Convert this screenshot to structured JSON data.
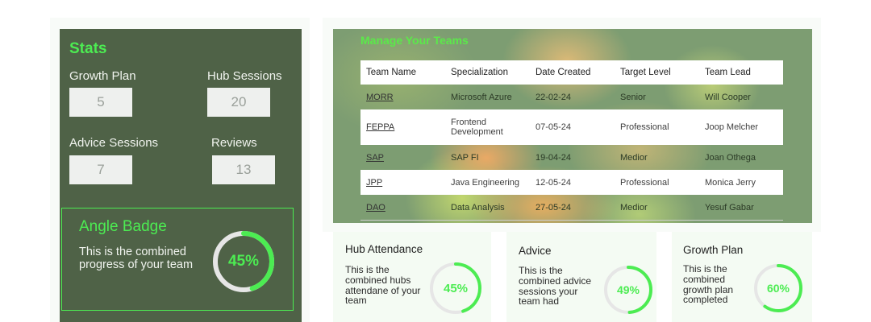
{
  "stats": {
    "title": "Stats",
    "growth_plan": {
      "label": "Growth Plan",
      "value": "5"
    },
    "hub_sessions": {
      "label": "Hub Sessions",
      "value": "20"
    },
    "advice_sessions": {
      "label": "Advice Sessions",
      "value": "7"
    },
    "reviews": {
      "label": "Reviews",
      "value": "13"
    },
    "angle_badge": {
      "title": "Angle Badge",
      "text": "This is the combined progress of your team",
      "percent_label": "45%",
      "progress": 0.45
    }
  },
  "teams": {
    "title": "Manage Your Teams",
    "columns": [
      "Team Name",
      "Specialization",
      "Date Created",
      "Target Level",
      "Team Lead"
    ],
    "rows": [
      {
        "name": "MORR",
        "specialization": "Microsoft Azure",
        "date": "22-02-24",
        "level": "Senior",
        "lead": "Will Cooper"
      },
      {
        "name": "FEPPA",
        "specialization": "Frontend Development",
        "date": "07-05-24",
        "level": "Professional",
        "lead": "Joop Melcher"
      },
      {
        "name": "SAP",
        "specialization": "SAP FI",
        "date": "19-04-24",
        "level": "Medior",
        "lead": "Joan Othega"
      },
      {
        "name": "JPP",
        "specialization": "Java Engineering",
        "date": "12-05-24",
        "level": "Professional",
        "lead": "Monica Jerry"
      },
      {
        "name": "DAO",
        "specialization": "Data Analysis",
        "date": "27-05-24",
        "level": "Medior",
        "lead": "Yesuf Gabar"
      }
    ]
  },
  "cards": [
    {
      "title": "Hub Attendance",
      "text": "This is the combined hubs attendane of your team",
      "percent_label": "45%",
      "progress": 0.45
    },
    {
      "title": "Advice",
      "text": "This is the combined advice sessions your team had",
      "percent_label": "49%",
      "progress": 0.49
    },
    {
      "title": "Growth Plan",
      "text": "This is the combined growth plan completed",
      "percent_label": "60%",
      "progress": 0.6
    }
  ],
  "colors": {
    "accent_green": "#4cec52",
    "panel_dark": "#4f6247",
    "ring_track": "#e6e6e6"
  }
}
